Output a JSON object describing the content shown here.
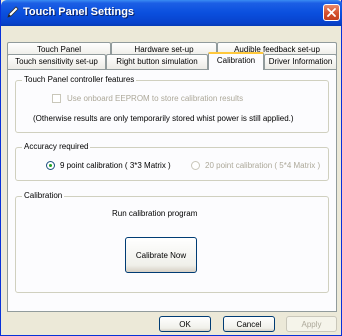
{
  "window": {
    "title": "Touch Panel Settings"
  },
  "tabs": {
    "top_row": [
      "Touch Panel",
      "Hardware set-up",
      "Audible feedback set-up"
    ],
    "bottom_row": [
      "Touch sensitivity set-up",
      "Right button simulation",
      "Calibration",
      "Driver Information"
    ],
    "active": "Calibration"
  },
  "controller_group": {
    "label": "Touch Panel controller features",
    "eeprom_checkbox_label": "Use onboard EEPROM to store calibration results",
    "eeprom_checked": false,
    "note": "(Otherwise results are only temporarily stored whist power is still applied.)"
  },
  "accuracy_group": {
    "label": "Accuracy required",
    "option_9pt": "9 point calibration ( 3*3 Matrix )",
    "option_20pt": "20 point calibration ( 5*4 Matrix )",
    "selected": "9 point calibration ( 3*3 Matrix )"
  },
  "calibration_group": {
    "label": "Calibration",
    "prompt": "Run calibration program",
    "button": "Calibrate Now"
  },
  "footer": {
    "ok": "OK",
    "cancel": "Cancel",
    "apply": "Apply"
  },
  "colors": {
    "titlebar": "#0a4fde",
    "window_bg": "#ece9d8",
    "active_tab_accent": "#ffc83c"
  },
  "icons": {
    "title_icon": "pen-icon",
    "close": "close-icon"
  }
}
